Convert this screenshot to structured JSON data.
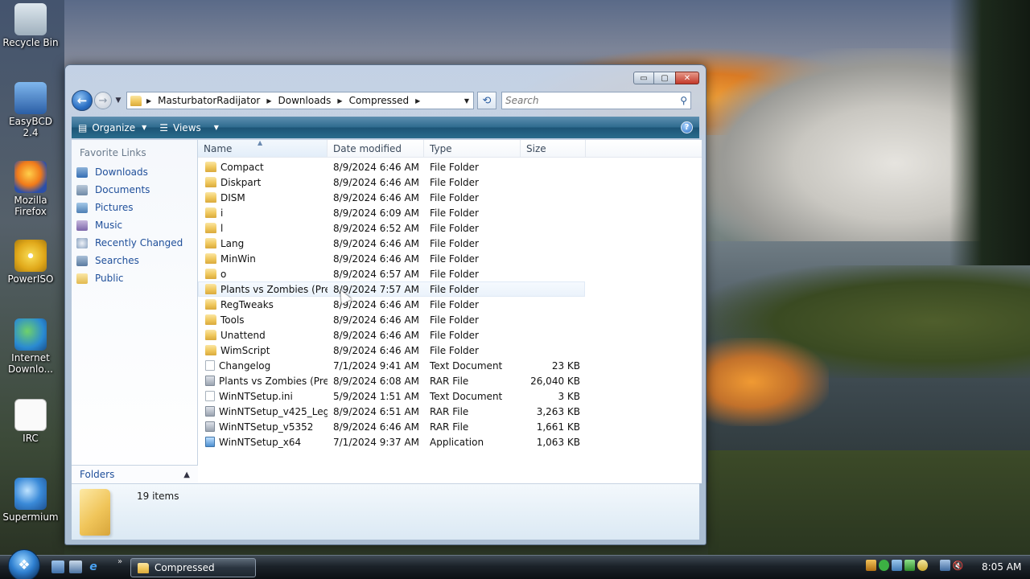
{
  "desktop": {
    "icons": [
      {
        "label": "Recycle Bin",
        "icon": "recycle-bin-icon"
      },
      {
        "label": "EasyBCD 2.4",
        "icon": "easybcd-icon"
      },
      {
        "label": "Mozilla Firefox",
        "icon": "firefox-icon"
      },
      {
        "label": "PowerISO",
        "icon": "poweriso-icon"
      },
      {
        "label": "Internet Downlo...",
        "icon": "internet-download-manager-icon"
      },
      {
        "label": "IRC",
        "icon": "text-file-icon"
      },
      {
        "label": "Supermium",
        "icon": "supermium-icon"
      }
    ]
  },
  "window": {
    "title_buttons": {
      "minimize": "▭",
      "maximize": "▢",
      "close": "✕"
    },
    "breadcrumb": [
      "MasturbatorRadijator",
      "Downloads",
      "Compressed"
    ],
    "search": {
      "placeholder": "Search",
      "value": ""
    },
    "toolbar": {
      "organize_label": "Organize",
      "views_label": "Views",
      "help": "?"
    },
    "favorites": {
      "title": "Favorite Links",
      "items": [
        "Downloads",
        "Documents",
        "Pictures",
        "Music",
        "Recently Changed",
        "Searches",
        "Public"
      ]
    },
    "folders_label": "Folders",
    "columns": {
      "name": "Name",
      "date": "Date modified",
      "type": "Type",
      "size": "Size"
    },
    "files": [
      {
        "name": "Compact",
        "date": "8/9/2024 6:46 AM",
        "type": "File Folder",
        "size": "",
        "icon": "folder"
      },
      {
        "name": "Diskpart",
        "date": "8/9/2024 6:46 AM",
        "type": "File Folder",
        "size": "",
        "icon": "folder"
      },
      {
        "name": "DISM",
        "date": "8/9/2024 6:46 AM",
        "type": "File Folder",
        "size": "",
        "icon": "folder"
      },
      {
        "name": "i",
        "date": "8/9/2024 6:09 AM",
        "type": "File Folder",
        "size": "",
        "icon": "folder"
      },
      {
        "name": "l",
        "date": "8/9/2024 6:52 AM",
        "type": "File Folder",
        "size": "",
        "icon": "folder"
      },
      {
        "name": "Lang",
        "date": "8/9/2024 6:46 AM",
        "type": "File Folder",
        "size": "",
        "icon": "folder"
      },
      {
        "name": "MinWin",
        "date": "8/9/2024 6:46 AM",
        "type": "File Folder",
        "size": "",
        "icon": "folder"
      },
      {
        "name": "o",
        "date": "8/9/2024 6:57 AM",
        "type": "File Folder",
        "size": "",
        "icon": "folder"
      },
      {
        "name": "Plants vs Zombies (Pre...",
        "date": "8/9/2024 7:57 AM",
        "type": "File Folder",
        "size": "",
        "icon": "folder"
      },
      {
        "name": "RegTweaks",
        "date": "8/9/2024 6:46 AM",
        "type": "File Folder",
        "size": "",
        "icon": "folder"
      },
      {
        "name": "Tools",
        "date": "8/9/2024 6:46 AM",
        "type": "File Folder",
        "size": "",
        "icon": "folder"
      },
      {
        "name": "Unattend",
        "date": "8/9/2024 6:46 AM",
        "type": "File Folder",
        "size": "",
        "icon": "folder"
      },
      {
        "name": "WimScript",
        "date": "8/9/2024 6:46 AM",
        "type": "File Folder",
        "size": "",
        "icon": "folder"
      },
      {
        "name": "Changelog",
        "date": "7/1/2024 9:41 AM",
        "type": "Text Document",
        "size": "23 KB",
        "icon": "text"
      },
      {
        "name": "Plants vs Zombies (Pre...",
        "date": "8/9/2024 6:08 AM",
        "type": "RAR File",
        "size": "26,040 KB",
        "icon": "rar"
      },
      {
        "name": "WinNTSetup.ini",
        "date": "5/9/2024 1:51 AM",
        "type": "Text Document",
        "size": "3 KB",
        "icon": "ini"
      },
      {
        "name": "WinNTSetup_v425_Leg...",
        "date": "8/9/2024 6:51 AM",
        "type": "RAR File",
        "size": "3,263 KB",
        "icon": "rar"
      },
      {
        "name": "WinNTSetup_v5352",
        "date": "8/9/2024 6:46 AM",
        "type": "RAR File",
        "size": "1,661 KB",
        "icon": "rar"
      },
      {
        "name": "WinNTSetup_x64",
        "date": "7/1/2024 9:37 AM",
        "type": "Application",
        "size": "1,063 KB",
        "icon": "app"
      }
    ],
    "details": {
      "item_count": "19 items"
    }
  },
  "taskbar": {
    "task_label": "Compressed",
    "clock": "8:05 AM",
    "more": "»"
  }
}
